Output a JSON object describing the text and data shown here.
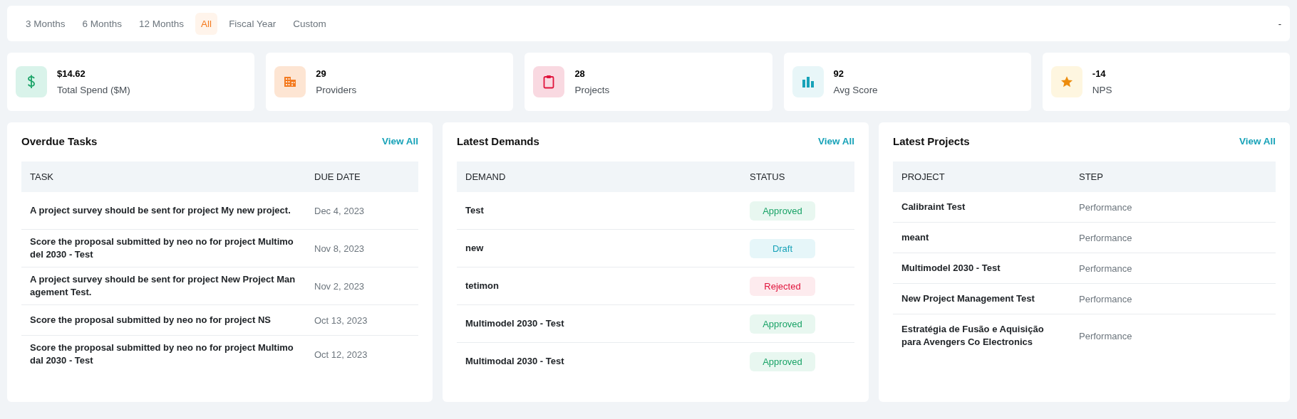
{
  "filters": [
    {
      "label": "3 Months",
      "selected": false
    },
    {
      "label": "6 Months",
      "selected": false
    },
    {
      "label": "12 Months",
      "selected": false
    },
    {
      "label": "All",
      "selected": true
    },
    {
      "label": "Fiscal Year",
      "selected": false
    },
    {
      "label": "Custom",
      "selected": false
    }
  ],
  "date_range": "-",
  "kpis": [
    {
      "value": "$14.62",
      "label": "Total Spend ($M)",
      "kind": "dollar"
    },
    {
      "value": "29",
      "label": "Providers",
      "kind": "building"
    },
    {
      "value": "28",
      "label": "Projects",
      "kind": "clipboard"
    },
    {
      "value": "92",
      "label": "Avg Score",
      "kind": "chart"
    },
    {
      "value": "-14",
      "label": "NPS",
      "kind": "star"
    }
  ],
  "overdue_tasks": {
    "title": "Overdue Tasks",
    "link": "View All",
    "columns": [
      "TASK",
      "DUE DATE"
    ],
    "rows": [
      {
        "task": "A project survey should be sent for project My new project.",
        "due": "Dec 4, 2023"
      },
      {
        "task": "Score the proposal submitted by neo no for project Multimodel 2030 - Test",
        "due": "Nov 8, 2023"
      },
      {
        "task": "A project survey should be sent for project New Project Management Test.",
        "due": "Nov 2, 2023"
      },
      {
        "task": "Score the proposal submitted by neo no for project NS",
        "due": "Oct 13, 2023"
      },
      {
        "task": "Score the proposal submitted by neo no for project Multimodal 2030 - Test",
        "due": "Oct 12, 2023"
      }
    ]
  },
  "latest_demands": {
    "title": "Latest Demands",
    "link": "View All",
    "columns": [
      "DEMAND",
      "STATUS"
    ],
    "rows": [
      {
        "demand": "Test",
        "status": "Approved",
        "kind": "approved"
      },
      {
        "demand": "new",
        "status": "Draft",
        "kind": "draft"
      },
      {
        "demand": "tetimon",
        "status": "Rejected",
        "kind": "rejected"
      },
      {
        "demand": "Multimodel 2030 - Test",
        "status": "Approved",
        "kind": "approved"
      },
      {
        "demand": "Multimodal 2030 - Test",
        "status": "Approved",
        "kind": "approved"
      }
    ]
  },
  "latest_projects": {
    "title": "Latest Projects",
    "link": "View All",
    "columns": [
      "PROJECT",
      "STEP"
    ],
    "rows": [
      {
        "project": "Calibraint Test",
        "step": "Performance"
      },
      {
        "project": "meant",
        "step": "Performance"
      },
      {
        "project": "Multimodel 2030 - Test",
        "step": "Performance"
      },
      {
        "project": "New Project Management Test",
        "step": "Performance"
      },
      {
        "project": "Estratégia de Fusão e Aquisição para Avengers Co Electronics",
        "step": "Performance"
      }
    ]
  }
}
